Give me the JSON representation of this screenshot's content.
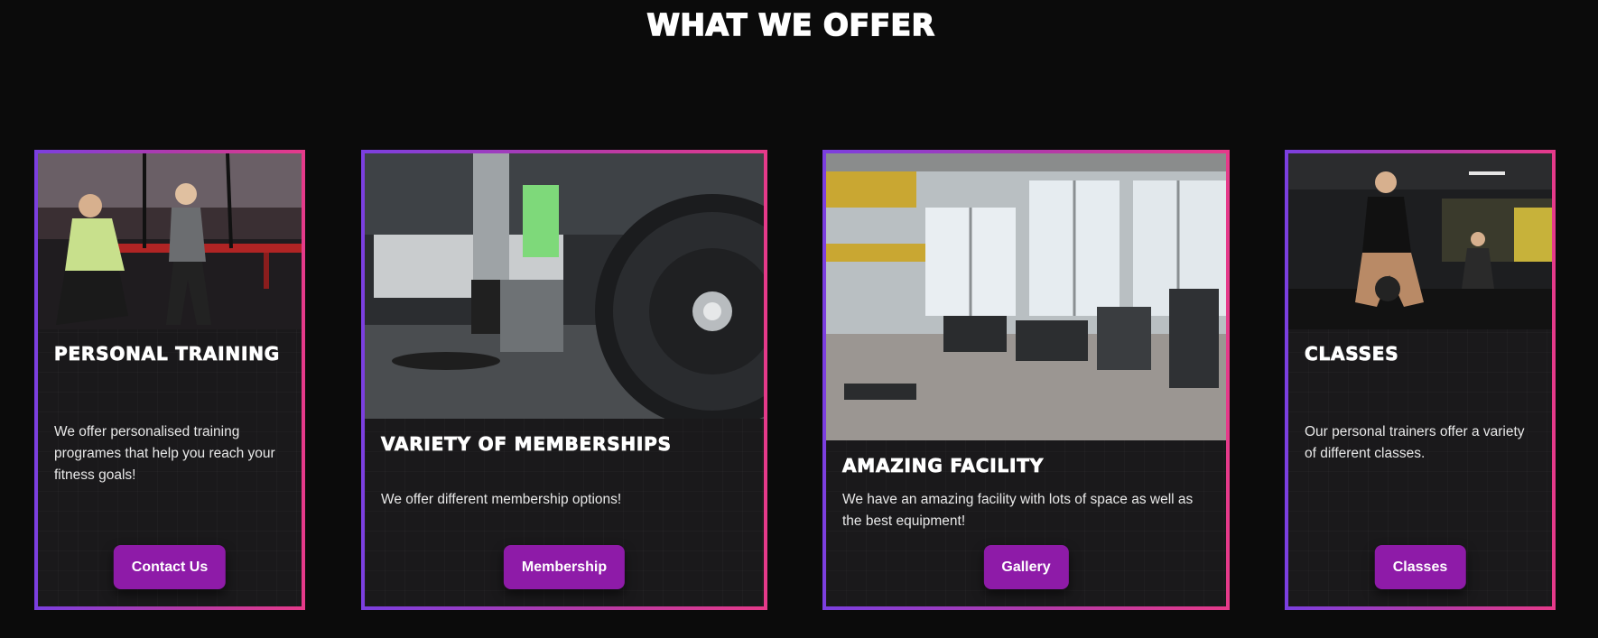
{
  "section": {
    "title": "WHAT WE OFFER"
  },
  "cards": [
    {
      "title": "PERSONAL TRAINING",
      "text": "We offer personalised training programes that help you reach your fitness goals!",
      "button": "Contact Us",
      "image": "trx-training-photo"
    },
    {
      "title": "VARIETY OF MEMBERSHIPS",
      "text": "We offer different membership options!",
      "button": "Membership",
      "image": "barbell-plate-photo"
    },
    {
      "title": "AMAZING FACILITY",
      "text": "We have an amazing facility with lots of space as well as the best equipment!",
      "button": "Gallery",
      "image": "gym-interior-photo"
    },
    {
      "title": "CLASSES",
      "text": "Our personal trainers offer a variety of different classes.",
      "button": "Classes",
      "image": "kettlebell-class-photo"
    }
  ],
  "colors": {
    "background": "#0b0b0b",
    "card": "#1a191b",
    "border_start": "#7b3fe0",
    "border_end": "#e63a8a",
    "button": "#8e1ba8"
  }
}
